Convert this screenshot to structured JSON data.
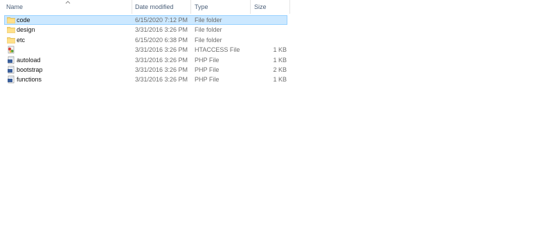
{
  "columns": {
    "name": "Name",
    "date": "Date modified",
    "type": "Type",
    "size": "Size"
  },
  "sort": {
    "column": "name",
    "direction": "ascending",
    "icon": "chevron-up-icon"
  },
  "files": [
    {
      "name": "code",
      "date": "6/15/2020 7:12 PM",
      "type": "File folder",
      "size": "",
      "icon": "folder-icon",
      "selected": true
    },
    {
      "name": "design",
      "date": "3/31/2016 3:26 PM",
      "type": "File folder",
      "size": "",
      "icon": "folder-icon",
      "selected": false
    },
    {
      "name": "etc",
      "date": "6/15/2020 6:38 PM",
      "type": "File folder",
      "size": "",
      "icon": "folder-icon",
      "selected": false
    },
    {
      "name": "",
      "date": "3/31/2016 3:26 PM",
      "type": "HTACCESS File",
      "size": "1 KB",
      "icon": "htaccess-file-icon",
      "selected": false
    },
    {
      "name": "autoload",
      "date": "3/31/2016 3:26 PM",
      "type": "PHP File",
      "size": "1 KB",
      "icon": "php-file-icon",
      "selected": false
    },
    {
      "name": "bootstrap",
      "date": "3/31/2016 3:26 PM",
      "type": "PHP File",
      "size": "2 KB",
      "icon": "php-file-icon",
      "selected": false
    },
    {
      "name": "functions",
      "date": "3/31/2016 3:26 PM",
      "type": "PHP File",
      "size": "1 KB",
      "icon": "php-file-icon",
      "selected": false
    }
  ],
  "colors": {
    "selection_bg": "#cce8ff",
    "selection_border": "#99d1ff",
    "folder": "#f8d775",
    "header_text": "#4c607a"
  }
}
